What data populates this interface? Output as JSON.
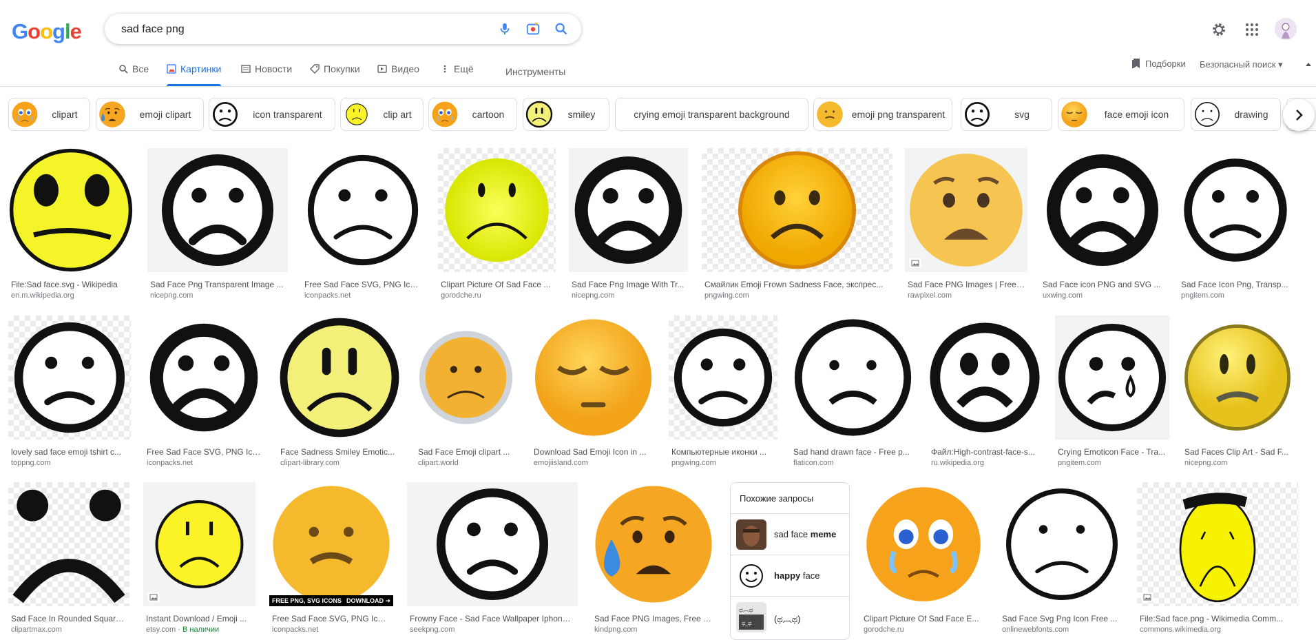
{
  "logo": [
    "G",
    "o",
    "o",
    "g",
    "l",
    "e"
  ],
  "logo_colors": [
    "#4285F4",
    "#EA4335",
    "#FBBC05",
    "#4285F4",
    "#34A853",
    "#EA4335"
  ],
  "search": {
    "query": "sad face png"
  },
  "tabs": [
    {
      "label": "Все",
      "icon": "search-icon"
    },
    {
      "label": "Картинки",
      "icon": "images-icon",
      "active": true
    },
    {
      "label": "Новости",
      "icon": "news-icon"
    },
    {
      "label": "Покупки",
      "icon": "tag-icon"
    },
    {
      "label": "Видео",
      "icon": "video-icon"
    },
    {
      "label": "Ещё",
      "icon": "more-dots-icon"
    }
  ],
  "tools_label": "Инструменты",
  "saved_label": "Подборки",
  "safesearch_label": "Безопасный поиск",
  "chips": [
    {
      "label": "clipart",
      "style": "cry-yellow"
    },
    {
      "label": "emoji clipart",
      "style": "cry-orange"
    },
    {
      "label": "icon transparent",
      "style": "outline"
    },
    {
      "label": "clip art",
      "style": "yellow-plain"
    },
    {
      "label": "cartoon",
      "style": "cartoon"
    },
    {
      "label": "smiley",
      "style": "yellow-bold"
    },
    {
      "label": "crying emoji transparent background",
      "style": "none"
    },
    {
      "label": "emoji png transparent",
      "style": "emoji-tear"
    },
    {
      "label": "svg",
      "style": "outline"
    },
    {
      "label": "face emoji icon",
      "style": "pensive"
    },
    {
      "label": "drawing",
      "style": "sketch"
    },
    {
      "label": "",
      "style": "yellow-plain"
    }
  ],
  "results": [
    {
      "title": "File:Sad face.svg - Wikipedia",
      "source": "en.m.wikipedia.org"
    },
    {
      "title": "Sad Face Png Transparent Image ...",
      "source": "nicepng.com"
    },
    {
      "title": "Free Sad Face SVG, PNG Icon...",
      "source": "iconpacks.net"
    },
    {
      "title": "Clipart Picture Of Sad Face ...",
      "source": "gorodche.ru"
    },
    {
      "title": "Sad Face Png Image With Tr...",
      "source": "nicepng.com"
    },
    {
      "title": "Смайлик Emoji Frown Sadness Face, экспрес...",
      "source": "pngwing.com"
    },
    {
      "title": "Sad Face PNG Images | Free ...",
      "source": "rawpixel.com"
    },
    {
      "title": "Sad Face icon PNG and SVG ...",
      "source": "uxwing.com"
    },
    {
      "title": "Sad Face Icon Png, Transp...",
      "source": "pngitem.com"
    },
    {
      "title": "lovely sad face emoji tshirt c...",
      "source": "toppng.com"
    },
    {
      "title": "Free Sad Face SVG, PNG Ico...",
      "source": "iconpacks.net"
    },
    {
      "title": "Face Sadness Smiley Emotic...",
      "source": "clipart-library.com"
    },
    {
      "title": "Sad Face Emoji clipart ...",
      "source": "clipart.world"
    },
    {
      "title": "Download Sad Emoji Icon in ...",
      "source": "emojiisland.com"
    },
    {
      "title": "Компьютерные иконки ...",
      "source": "pngwing.com"
    },
    {
      "title": "Sad hand drawn face - Free p...",
      "source": "flaticon.com"
    },
    {
      "title": "Файл:High-contrast-face-s...",
      "source": "ru.wikipedia.org"
    },
    {
      "title": "Crying Emoticon Face - Tra...",
      "source": "pngitem.com"
    },
    {
      "title": "Sad Faces Clip Art - Sad F...",
      "source": "nicepng.com"
    },
    {
      "title": "Sad Face In Rounded Square...",
      "source": "clipartmax.com"
    },
    {
      "title": "Instant Download / Emoji ...",
      "source": "etsy.com",
      "stock": "В наличии"
    },
    {
      "title": "Free Sad Face SVG, PNG Icon...",
      "source": "iconpacks.net",
      "banner_left": "FREE PNG, SVG ICONS",
      "banner_right": "DOWNLOAD ➜"
    },
    {
      "title": "Frowny Face - Sad Face Wallpaper Iphone ...",
      "source": "seekpng.com"
    },
    {
      "title": "Sad Face PNG Images, Free T...",
      "source": "kindpng.com"
    },
    {
      "title": "Clipart Picture Of Sad Face E...",
      "source": "gorodche.ru"
    },
    {
      "title": "Sad Face Svg Png Icon Free ...",
      "source": "onlinewebfonts.com"
    },
    {
      "title": "File:Sad face.png - Wikimedia Comm...",
      "source": "commons.wikimedia.org"
    }
  ],
  "related": {
    "title": "Похожие запросы",
    "items": [
      {
        "pre": "sad face ",
        "bold": "meme",
        "post": ""
      },
      {
        "pre": "",
        "bold": "happy",
        "post": " face"
      },
      {
        "pre": "(ಥ︹ಥ)",
        "bold": "",
        "post": ""
      }
    ]
  }
}
